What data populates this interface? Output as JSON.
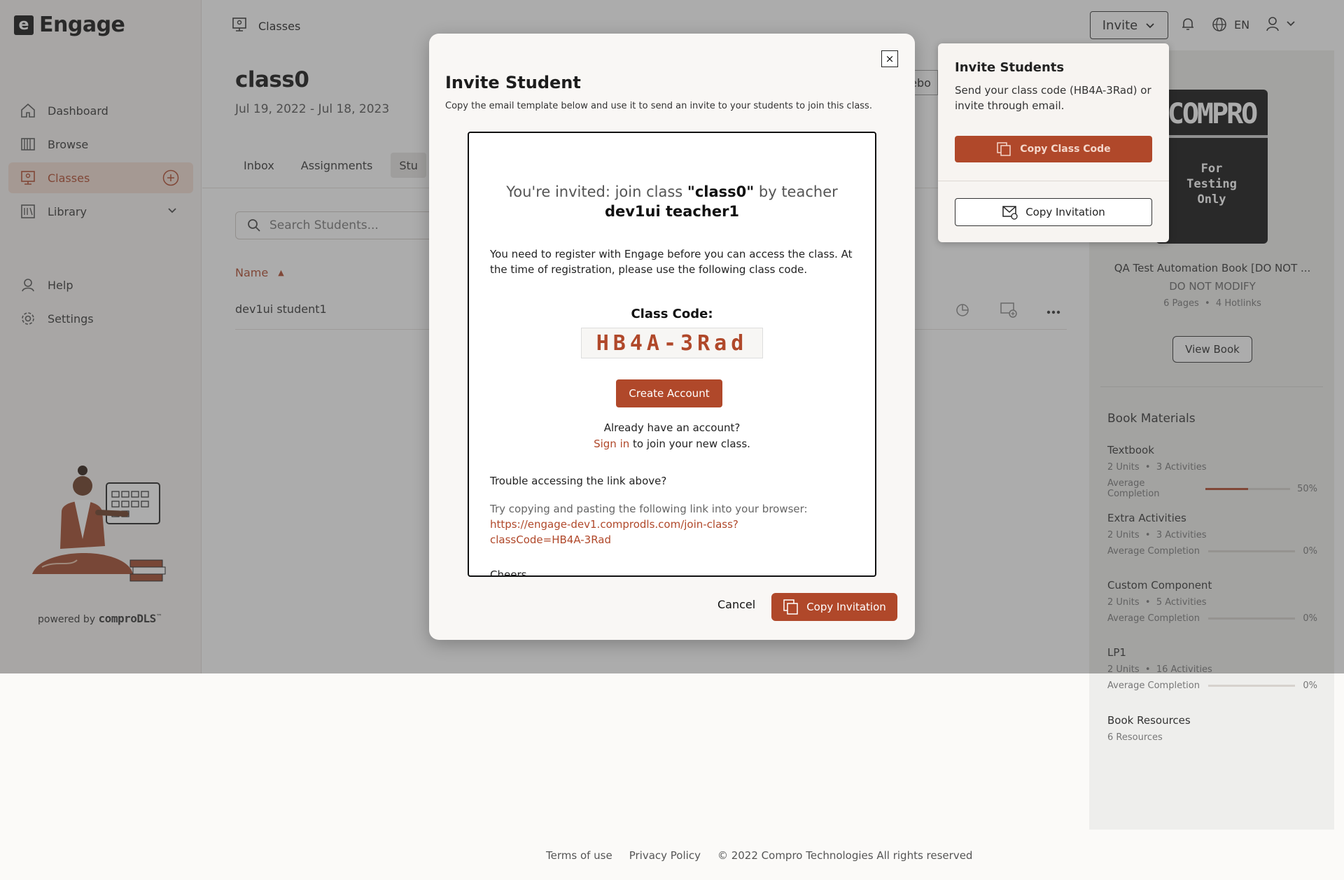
{
  "app": {
    "logo_letter": "e",
    "logo_text": "Engage"
  },
  "sidebar": {
    "items": [
      {
        "label": "Dashboard",
        "icon": "home-icon"
      },
      {
        "label": "Browse",
        "icon": "books-icon"
      },
      {
        "label": "Classes",
        "icon": "classroom-icon",
        "active": true
      },
      {
        "label": "Library",
        "icon": "library-icon"
      }
    ],
    "secondary": [
      {
        "label": "Help",
        "icon": "help-icon"
      },
      {
        "label": "Settings",
        "icon": "gear-icon"
      }
    ],
    "powered_prefix": "powered by",
    "powered_brand": "comproDLS",
    "powered_tm": "™"
  },
  "header": {
    "breadcrumb": "Classes",
    "invite_label": "Invite",
    "language": "EN"
  },
  "class": {
    "title": "class0",
    "dates": "Jul 19, 2022 - Jul 18, 2023",
    "tabs": [
      "Inbox",
      "Assignments",
      "Stu"
    ],
    "partial_tab": "debo",
    "search_placeholder": "Search Students...",
    "column_name": "Name",
    "sort_indicator": "▲",
    "students": [
      "dev1ui student1"
    ]
  },
  "book": {
    "cover_title": "COMPRO",
    "cover_lines": [
      "For",
      "Testing",
      "Only"
    ],
    "title": "QA Test Automation Book [DO NOT ...",
    "subtitle": "DO NOT MODIFY",
    "pages": "6 Pages",
    "hotlinks": "4 Hotlinks",
    "view_label": "View Book",
    "materials_heading": "Book Materials",
    "materials": [
      {
        "title": "Textbook",
        "units": "2 Units",
        "activities": "3 Activities",
        "avg_label": "Average Completion",
        "pct": "50%",
        "progress": 0.5
      },
      {
        "title": "Extra Activities",
        "units": "2 Units",
        "activities": "3 Activities",
        "avg_label": "Average Completion",
        "pct": "0%",
        "progress": 0
      },
      {
        "title": "Custom Component",
        "units": "2 Units",
        "activities": "5 Activities",
        "avg_label": "Average Completion",
        "pct": "0%",
        "progress": 0
      },
      {
        "title": "LP1",
        "units": "2 Units",
        "activities": "16 Activities",
        "avg_label": "Average Completion",
        "pct": "0%",
        "progress": 0
      }
    ],
    "resources_title": "Book Resources",
    "resources_count": "6 Resources"
  },
  "popover": {
    "title": "Invite Students",
    "text": "Send your class code (HB4A-3Rad) or invite through email.",
    "copy_code_label": "Copy Class Code",
    "copy_invitation_label": "Copy Invitation"
  },
  "modal": {
    "close_symbol": "×",
    "title": "Invite Student",
    "description": "Copy the email template below and use it to send an invite to your students to join this class.",
    "invite_prefix": "You're invited: join class ",
    "invite_class": "\"class0\"",
    "invite_mid": " by teacher",
    "invite_teacher": "dev1ui teacher1",
    "register_text": "You need to register with Engage before you can access the class. At the time of registration, please use the following class code.",
    "class_code_label": "Class Code:",
    "class_code": "HB4A-3Rad",
    "create_account": "Create Account",
    "already_text": "Already have an account?",
    "sign_in": "Sign in",
    "sign_in_suffix": " to join your new class.",
    "trouble_text": "Trouble accessing the link above?",
    "try_text": "Try copying and pasting the following link into your browser:",
    "join_link": "https://engage-dev1.comprodls.com/join-class?classCode=HB4A-3Rad",
    "cheers": "Cheers,",
    "cancel_label": "Cancel",
    "copy_invitation_label": "Copy Invitation"
  },
  "footer": {
    "terms": "Terms of use",
    "privacy": "Privacy Policy",
    "copyright": "© 2022 Compro Technologies All rights reserved"
  },
  "colors": {
    "accent": "#b0482a",
    "accent_light": "#f3dcd2"
  }
}
